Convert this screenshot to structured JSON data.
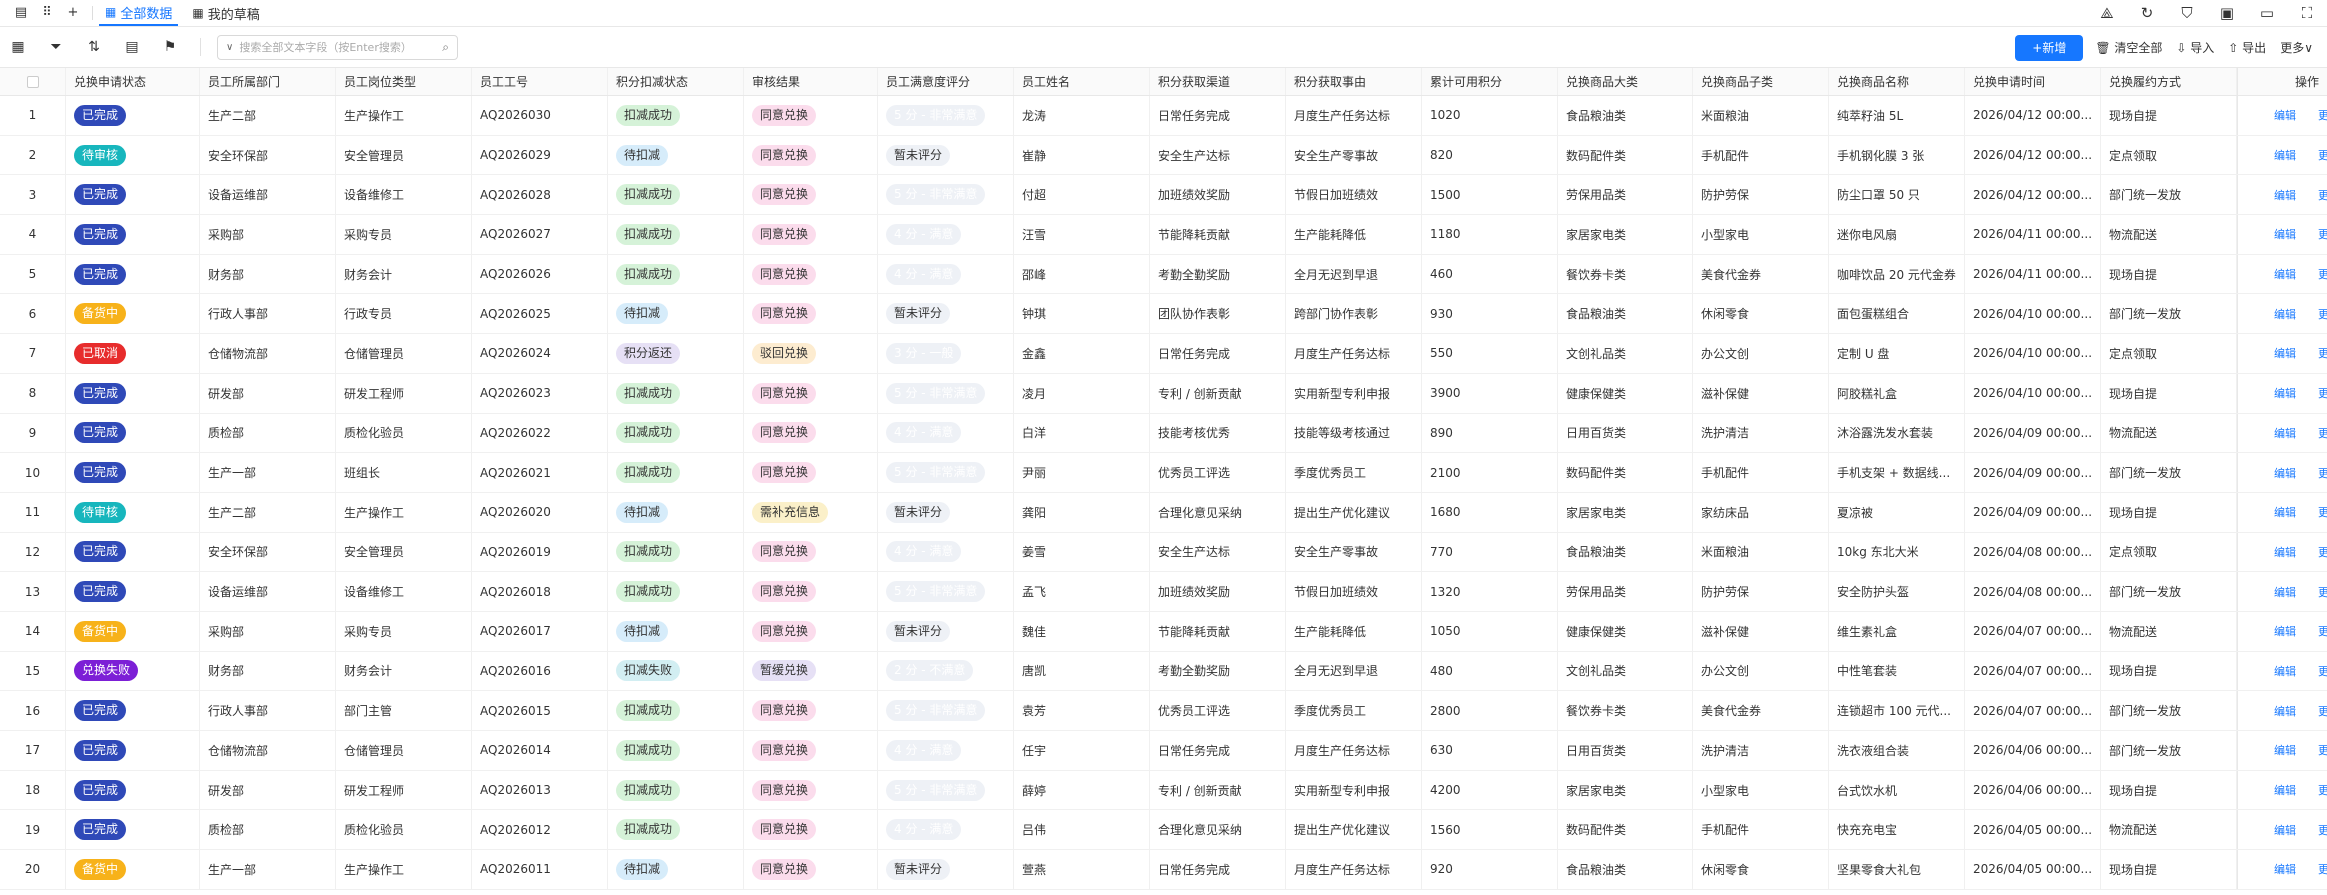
{
  "top": {
    "tabs": [
      {
        "label": "全部数据",
        "active": true
      },
      {
        "label": "我的草稿",
        "active": false
      }
    ]
  },
  "toolbar": {
    "search_placeholder": "搜索全部文本字段（按Enter搜索）",
    "new_label": "新增",
    "clear_label": "清空全部",
    "import_label": "导入",
    "export_label": "导出",
    "more_label": "更多"
  },
  "columns": [
    "兑换申请状态",
    "员工所属部门",
    "员工岗位类型",
    "员工工号",
    "积分扣减状态",
    "审核结果",
    "员工满意度评分",
    "员工姓名",
    "积分获取渠道",
    "积分获取事由",
    "累计可用积分",
    "兑换商品大类",
    "兑换商品子类",
    "兑换商品名称",
    "兑换申请时间",
    "兑换履约方式"
  ],
  "action_header": "操作",
  "action_labels": {
    "edit": "编辑",
    "more": "更多"
  },
  "colors": {
    "已完成": "#2f49b8",
    "待审核": "#17b6bd",
    "备货中": "#f7b21a",
    "已取消": "#e72c2c",
    "兑换失败": "#7c1fd6",
    "扣减成功": "#d5f2d8",
    "待扣减": "#d6ecfa",
    "积分返还": "#e6e0f5",
    "扣减失败": "#d2eef2",
    "同意兑换": "#fbdcec",
    "驳回兑换": "#fdecd0",
    "需补充信息": "#fbf0c9",
    "暂缓兑换": "#e6e0f5",
    "5分 - 非常满意": "#1890ff",
    "4分 - 满意": "#23b45a",
    "3分 - 一般": "#17b6bd",
    "暂未评分": "#eef1f6",
    "2分 - 不满意": "#2f49b8"
  },
  "rows": [
    [
      "1",
      "已完成",
      "生产二部",
      "生产操作工",
      "AQ2026030",
      "扣减成功",
      "同意兑换",
      "5 分 - 非常满意",
      "龙涛",
      "日常任务完成",
      "月度生产任务达标",
      "1020",
      "食品粮油类",
      "米面粮油",
      "纯萃籽油 5L",
      "2026/04/12 00:00...",
      "现场自提"
    ],
    [
      "2",
      "待审核",
      "安全环保部",
      "安全管理员",
      "AQ2026029",
      "待扣减",
      "同意兑换",
      "暂未评分",
      "崔静",
      "安全生产达标",
      "安全生产零事故",
      "820",
      "数码配件类",
      "手机配件",
      "手机钢化膜 3 张",
      "2026/04/12 00:00...",
      "定点领取"
    ],
    [
      "3",
      "已完成",
      "设备运维部",
      "设备维修工",
      "AQ2026028",
      "扣减成功",
      "同意兑换",
      "5 分 - 非常满意",
      "付超",
      "加班绩效奖励",
      "节假日加班绩效",
      "1500",
      "劳保用品类",
      "防护劳保",
      "防尘口罩 50 只",
      "2026/04/12 00:00...",
      "部门统一发放"
    ],
    [
      "4",
      "已完成",
      "采购部",
      "采购专员",
      "AQ2026027",
      "扣减成功",
      "同意兑换",
      "4 分 - 满意",
      "汪雪",
      "节能降耗贡献",
      "生产能耗降低",
      "1180",
      "家居家电类",
      "小型家电",
      "迷你电风扇",
      "2026/04/11 00:00...",
      "物流配送"
    ],
    [
      "5",
      "已完成",
      "财务部",
      "财务会计",
      "AQ2026026",
      "扣减成功",
      "同意兑换",
      "4 分 - 满意",
      "邵峰",
      "考勤全勤奖励",
      "全月无迟到早退",
      "460",
      "餐饮券卡类",
      "美食代金券",
      "咖啡饮品 20 元代金券",
      "2026/04/11 00:00...",
      "现场自提"
    ],
    [
      "6",
      "备货中",
      "行政人事部",
      "行政专员",
      "AQ2026025",
      "待扣减",
      "同意兑换",
      "暂未评分",
      "钟琪",
      "团队协作表彰",
      "跨部门协作表彰",
      "930",
      "食品粮油类",
      "休闲零食",
      "面包蛋糕组合",
      "2026/04/10 00:00...",
      "部门统一发放"
    ],
    [
      "7",
      "已取消",
      "仓储物流部",
      "仓储管理员",
      "AQ2026024",
      "积分返还",
      "驳回兑换",
      "3 分 - 一般",
      "金鑫",
      "日常任务完成",
      "月度生产任务达标",
      "550",
      "文创礼品类",
      "办公文创",
      "定制 U 盘",
      "2026/04/10 00:00...",
      "定点领取"
    ],
    [
      "8",
      "已完成",
      "研发部",
      "研发工程师",
      "AQ2026023",
      "扣减成功",
      "同意兑换",
      "5 分 - 非常满意",
      "凌月",
      "专利 / 创新贡献",
      "实用新型专利申报",
      "3900",
      "健康保健类",
      "滋补保健",
      "阿胶糕礼盒",
      "2026/04/10 00:00...",
      "现场自提"
    ],
    [
      "9",
      "已完成",
      "质检部",
      "质检化验员",
      "AQ2026022",
      "扣减成功",
      "同意兑换",
      "4 分 - 满意",
      "白洋",
      "技能考核优秀",
      "技能等级考核通过",
      "890",
      "日用百货类",
      "洗护清洁",
      "沐浴露洗发水套装",
      "2026/04/09 00:00...",
      "物流配送"
    ],
    [
      "10",
      "已完成",
      "生产一部",
      "班组长",
      "AQ2026021",
      "扣减成功",
      "同意兑换",
      "5 分 - 非常满意",
      "尹丽",
      "优秀员工评选",
      "季度优秀员工",
      "2100",
      "数码配件类",
      "手机配件",
      "手机支架 + 数据线...",
      "2026/04/09 00:00...",
      "部门统一发放"
    ],
    [
      "11",
      "待审核",
      "生产二部",
      "生产操作工",
      "AQ2026020",
      "待扣减",
      "需补充信息",
      "暂未评分",
      "龚阳",
      "合理化意见采纳",
      "提出生产优化建议",
      "1680",
      "家居家电类",
      "家纺床品",
      "夏凉被",
      "2026/04/09 00:00...",
      "现场自提"
    ],
    [
      "12",
      "已完成",
      "安全环保部",
      "安全管理员",
      "AQ2026019",
      "扣减成功",
      "同意兑换",
      "4 分 - 满意",
      "姜雪",
      "安全生产达标",
      "安全生产零事故",
      "770",
      "食品粮油类",
      "米面粮油",
      "10kg 东北大米",
      "2026/04/08 00:00...",
      "定点领取"
    ],
    [
      "13",
      "已完成",
      "设备运维部",
      "设备维修工",
      "AQ2026018",
      "扣减成功",
      "同意兑换",
      "5 分 - 非常满意",
      "孟飞",
      "加班绩效奖励",
      "节假日加班绩效",
      "1320",
      "劳保用品类",
      "防护劳保",
      "安全防护头盔",
      "2026/04/08 00:00...",
      "部门统一发放"
    ],
    [
      "14",
      "备货中",
      "采购部",
      "采购专员",
      "AQ2026017",
      "待扣减",
      "同意兑换",
      "暂未评分",
      "魏佳",
      "节能降耗贡献",
      "生产能耗降低",
      "1050",
      "健康保健类",
      "滋补保健",
      "维生素礼盒",
      "2026/04/07 00:00...",
      "物流配送"
    ],
    [
      "15",
      "兑换失败",
      "财务部",
      "财务会计",
      "AQ2026016",
      "扣减失败",
      "暂缓兑换",
      "2 分 - 不满意",
      "唐凯",
      "考勤全勤奖励",
      "全月无迟到早退",
      "480",
      "文创礼品类",
      "办公文创",
      "中性笔套装",
      "2026/04/07 00:00...",
      "现场自提"
    ],
    [
      "16",
      "已完成",
      "行政人事部",
      "部门主管",
      "AQ2026015",
      "扣减成功",
      "同意兑换",
      "5 分 - 非常满意",
      "袁芳",
      "优秀员工评选",
      "季度优秀员工",
      "2800",
      "餐饮券卡类",
      "美食代金券",
      "连锁超市 100 元代...",
      "2026/04/07 00:00...",
      "部门统一发放"
    ],
    [
      "17",
      "已完成",
      "仓储物流部",
      "仓储管理员",
      "AQ2026014",
      "扣减成功",
      "同意兑换",
      "4 分 - 满意",
      "任宇",
      "日常任务完成",
      "月度生产任务达标",
      "630",
      "日用百货类",
      "洗护清洁",
      "洗衣液组合装",
      "2026/04/06 00:00...",
      "部门统一发放"
    ],
    [
      "18",
      "已完成",
      "研发部",
      "研发工程师",
      "AQ2026013",
      "扣减成功",
      "同意兑换",
      "5 分 - 非常满意",
      "薛婷",
      "专利 / 创新贡献",
      "实用新型专利申报",
      "4200",
      "家居家电类",
      "小型家电",
      "台式饮水机",
      "2026/04/06 00:00...",
      "现场自提"
    ],
    [
      "19",
      "已完成",
      "质检部",
      "质检化验员",
      "AQ2026012",
      "扣减成功",
      "同意兑换",
      "4 分 - 满意",
      "吕伟",
      "合理化意见采纳",
      "提出生产优化建议",
      "1560",
      "数码配件类",
      "手机配件",
      "快充充电宝",
      "2026/04/05 00:00...",
      "物流配送"
    ],
    [
      "20",
      "备货中",
      "生产一部",
      "生产操作工",
      "AQ2026011",
      "待扣减",
      "同意兑换",
      "暂未评分",
      "萱燕",
      "日常任务完成",
      "月度生产任务达标",
      "920",
      "食品粮油类",
      "休闲零食",
      "坚果零食大礼包",
      "2026/04/05 00:00...",
      "现场自提"
    ]
  ]
}
